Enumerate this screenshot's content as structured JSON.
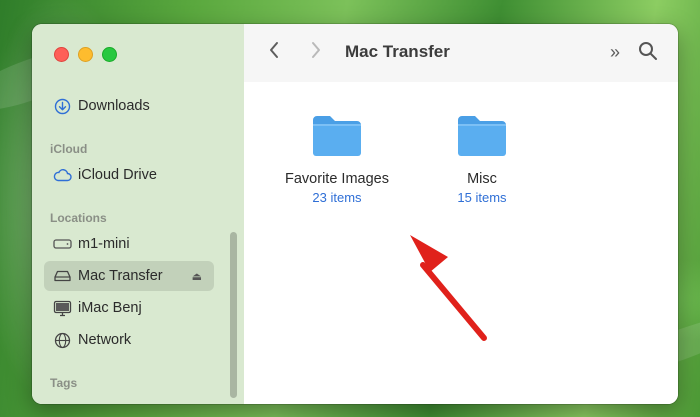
{
  "window": {
    "title": "Mac Transfer"
  },
  "sidebar": {
    "favorites": [
      {
        "label": "Downloads",
        "icon": "download-icon"
      }
    ],
    "icloud_heading": "iCloud",
    "icloud": [
      {
        "label": "iCloud Drive",
        "icon": "cloud-icon"
      }
    ],
    "locations_heading": "Locations",
    "locations": [
      {
        "label": "m1-mini",
        "icon": "drive-icon"
      },
      {
        "label": "Mac Transfer",
        "icon": "external-drive-icon",
        "selected": true,
        "eject": "⏏"
      },
      {
        "label": "iMac Benj",
        "icon": "display-icon"
      },
      {
        "label": "Network",
        "icon": "globe-icon"
      }
    ],
    "tags_heading": "Tags"
  },
  "toolbar": {
    "back": "‹",
    "forward": "›",
    "more": "»"
  },
  "folders": [
    {
      "name": "Favorite Images",
      "count": "23 items"
    },
    {
      "name": "Misc",
      "count": "15 items"
    }
  ],
  "colors": {
    "accent": "#2f6fd6",
    "folder": "#5aaef0",
    "arrow": "#e0211b",
    "sidebar": "#d7e8ce"
  }
}
